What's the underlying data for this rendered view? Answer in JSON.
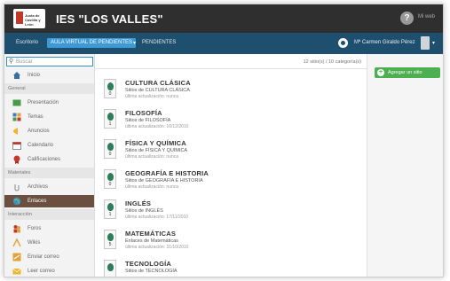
{
  "header": {
    "logo_text": "Junta de Castilla y León",
    "site_title": "IES \"LOS VALLES\"",
    "help_label": "?",
    "user_short": "Mi web",
    "colors": {
      "topbar": "#2f2f2f",
      "navbar": "#1f4f6f",
      "accent": "#3d9ad4",
      "success": "#4caf50"
    }
  },
  "nav": {
    "mode": "Escritorio",
    "course": "AULA VIRTUAL DE PENDIENTES",
    "course_caret": "▾",
    "status": "PENDIENTES",
    "user": "Mª Carmen Giraldo Pérez",
    "avatar_caret": "▾"
  },
  "sidebar": {
    "search_placeholder": "Buscar",
    "search_icon": "search-icon",
    "home": "Inicio",
    "sections": [
      "General",
      "Materiales",
      "Interacción"
    ],
    "general_items": [
      "Presentación",
      "Temas",
      "Anuncios",
      "Calendario",
      "Calificaciones"
    ],
    "materiales_items": [
      "Archivos",
      "Enlaces"
    ],
    "interaccion_items": [
      "Foros",
      "Wikis",
      "Enviar correo",
      "Leer correo"
    ],
    "active_item": "Enlaces"
  },
  "main": {
    "count_text": "12 sitio(s) / 10 categoría(s)",
    "entries": [
      {
        "title": "CULTURA CLÁSICA",
        "subtitle": "Sitios de CULTURA CLÁSICA",
        "date": "última actualización: nunca",
        "count": "0"
      },
      {
        "title": "FILOSOFÍA",
        "subtitle": "Sitios de FILOSOFÍA",
        "date": "última actualización: 10/12/2010",
        "count": "1"
      },
      {
        "title": "FÍSICA Y QUÍMICA",
        "subtitle": "Sitios de FÍSICA Y QUÍMICA",
        "date": "última actualización: nunca",
        "count": "0"
      },
      {
        "title": "GEOGRAFÍA E HISTORIA",
        "subtitle": "Sitios de GEOGRAFÍA E HISTORIA",
        "date": "última actualización: nunca",
        "count": "0"
      },
      {
        "title": "INGLÉS",
        "subtitle": "Sitios de INGLÉS",
        "date": "última actualización: 17/11/2010",
        "count": "1"
      },
      {
        "title": "MATEMÁTICAS",
        "subtitle": "Enlaces de Matemáticas",
        "date": "última actualización: 31/10/2010",
        "count": "5"
      },
      {
        "title": "TECNOLOGÍA",
        "subtitle": "Sitios de TECNOLOGÍA",
        "date": "",
        "count": ""
      }
    ]
  },
  "right": {
    "add_button": "Agregar un sitio",
    "add_icon": "plus-icon"
  }
}
